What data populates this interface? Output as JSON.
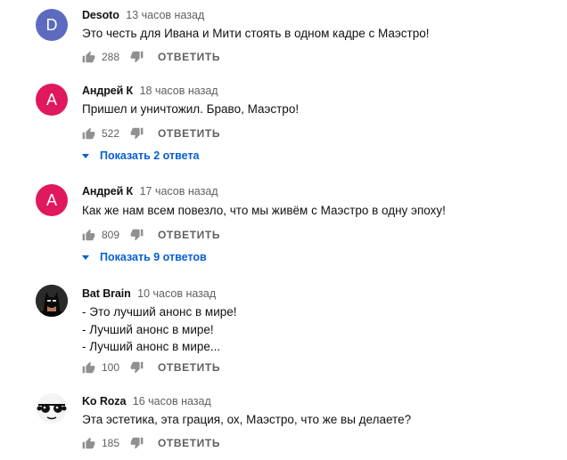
{
  "comments": [
    {
      "author": "Desoto",
      "time": "13 часов назад",
      "avatar_letter": "D",
      "avatar_color": "#5c6bc0",
      "text_lines": [
        "Это честь для Ивана и Мити стоять в одном кадре с Маэстро!"
      ],
      "likes": "288",
      "reply_label": "ОТВЕТИТЬ"
    },
    {
      "author": "Андрей К",
      "time": "18 часов назад",
      "avatar_letter": "А",
      "avatar_color": "#e0185e",
      "text_lines": [
        "Пришел и уничтожил. Браво, Маэстро!"
      ],
      "likes": "522",
      "reply_label": "ОТВЕТИТЬ",
      "replies_label": "Показать 2 ответа"
    },
    {
      "author": "Андрей К",
      "time": "17 часов назад",
      "avatar_letter": "А",
      "avatar_color": "#e0185e",
      "text_lines": [
        "Как же нам всем повезло, что мы живём с Маэстро в одну эпоху!"
      ],
      "likes": "809",
      "reply_label": "ОТВЕТИТЬ",
      "replies_label": "Показать 9 ответов"
    },
    {
      "author": "Bat Brain",
      "time": "10 часов назад",
      "avatar_color": "#1a1a1a",
      "text_lines": [
        "- Это лучший анонс в мире!",
        "- Лучший анонс в мире!",
        "- Лучший анонс в мире..."
      ],
      "likes": "100",
      "reply_label": "ОТВЕТИТЬ"
    },
    {
      "author": "Ko Roza",
      "time": "16 часов назад",
      "avatar_color": "#ffffff",
      "text_lines": [
        "Эта эстетика, эта грация, ох, Маэстро, что же вы делаете?"
      ],
      "likes": "185",
      "reply_label": "ОТВЕТИТЬ"
    }
  ],
  "icons": {
    "like": "thumbs-up-icon",
    "dislike": "thumbs-down-icon",
    "replies_toggle": "caret-down-icon"
  }
}
